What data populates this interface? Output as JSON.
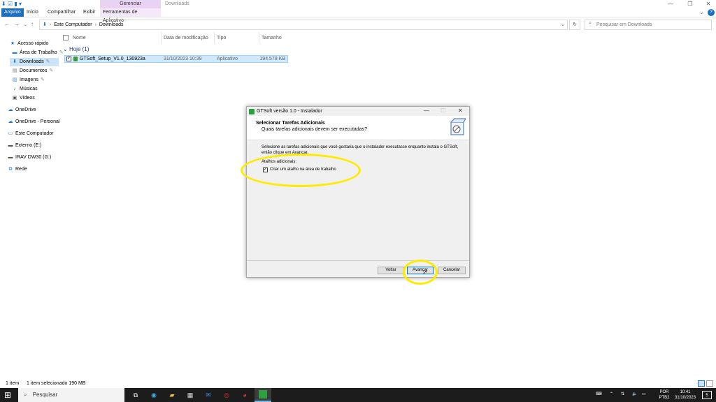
{
  "ribbon": {
    "context_header": "Gerenciar",
    "window_title": "Downloads",
    "tabs": [
      "Arquivo",
      "Início",
      "Compartilhar",
      "Exibir",
      "Ferramentas de Aplicativo"
    ]
  },
  "address": {
    "crumbs": [
      "Este Computador",
      "Downloads"
    ],
    "search_placeholder": "Pesquisar em Downloads"
  },
  "sidebar": {
    "items": [
      {
        "label": "Acesso rápido",
        "icon": "star-icon"
      },
      {
        "label": "Área de Trabalho",
        "icon": "desktop-icon"
      },
      {
        "label": "Downloads",
        "icon": "download-icon"
      },
      {
        "label": "Documentos",
        "icon": "document-icon"
      },
      {
        "label": "Imagens",
        "icon": "image-icon"
      },
      {
        "label": "Músicas",
        "icon": "music-icon"
      },
      {
        "label": "Vídeos",
        "icon": "video-icon"
      },
      {
        "label": "OneDrive",
        "icon": "cloud-icon"
      },
      {
        "label": "OneDrive - Personal",
        "icon": "cloud-icon"
      },
      {
        "label": "Este Computador",
        "icon": "computer-icon"
      },
      {
        "label": "Externo (E:)",
        "icon": "drive-icon"
      },
      {
        "label": "IRAV DW30 (G:)",
        "icon": "drive-icon"
      },
      {
        "label": "Rede",
        "icon": "network-icon"
      }
    ]
  },
  "columns": [
    "Nome",
    "Data de modificação",
    "Tipo",
    "Tamanho"
  ],
  "group": "Hoje (1)",
  "file": {
    "name": "GTSoft_Setup_V1.0_130923a",
    "date": "31/10/2023 10:39",
    "type": "Aplicativo",
    "size": "194.578 KB"
  },
  "dialog": {
    "title": "GTSoft versão 1.0 - Instalador",
    "heading": "Selecionar Tarefas Adicionais",
    "subheading": "Quais tarefas adicionais devem ser executadas?",
    "body": "Selecione as tarefas adicionais que você gostaria que o instalador executasse enquanto instala o GTSoft, então clique em Avançar.",
    "group_label": "Atalhos adicionais:",
    "checkbox_label": "Criar um atalho na área de trabalho",
    "checkbox_checked": true,
    "btn_back": "Voltar",
    "btn_next": "Avançar",
    "btn_cancel": "Cancelar"
  },
  "status": {
    "count": "1 item",
    "selected": "1 item selecionado  190 MB"
  },
  "taskbar": {
    "search": "Pesquisar",
    "lang": "POR",
    "kbd": "PTB2",
    "time": "10:41",
    "date": "31/10/2023",
    "notif_count": "5"
  },
  "colors": {
    "accent": "#1a6fc2",
    "highlight": "#ffeb00",
    "selection": "#cde8ff"
  }
}
